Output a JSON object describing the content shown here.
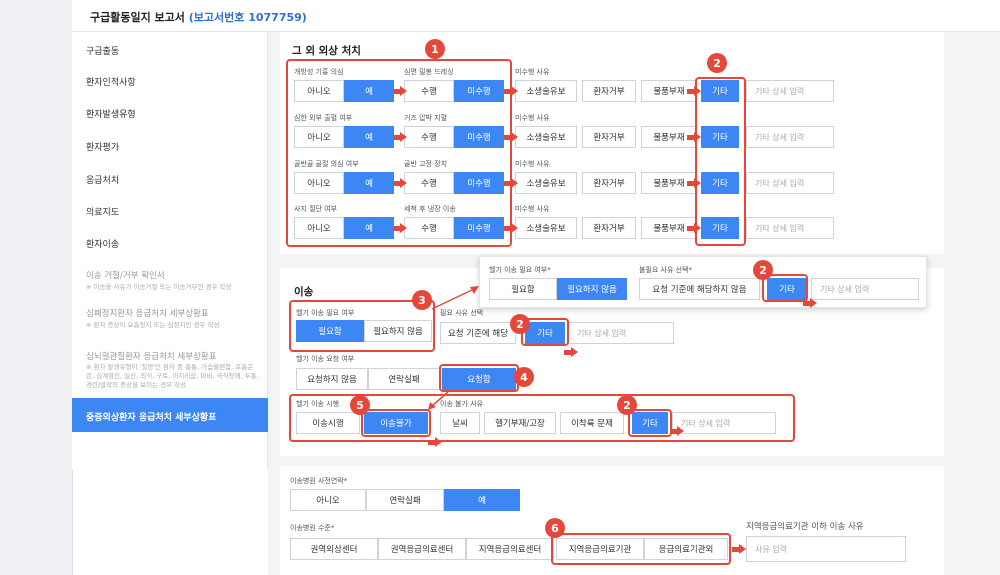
{
  "header": {
    "title": "구급활동일지 보고서",
    "report_no": "(보고서번호 1077759)"
  },
  "sidebar": {
    "items": [
      "구급출동",
      "환자인적사항",
      "환자발생유형",
      "환자평가",
      "응급처치",
      "의료지도",
      "환자이송"
    ],
    "subs": [
      {
        "title": "이송 거절/거부 확인서",
        "note": "※ 이송을 사유가 이송거절 또는 이송거부인 경우 작성"
      },
      {
        "title": "심폐정지환자 응급처치 세부상황표",
        "note": "※ 환자 증상이 요흡정지 또는 심정지인 경우 작성"
      },
      {
        "title": "심뇌혈관질환자 응급처치 세부상황표",
        "note": "※ 환자 발생유형이 '질병'인 환자 중 흉통, 가슴불편함, 호흡곤란, 심계항진, 실신, 의식, 구토, 어지러움, 마비, 극식장애, 두통, 경련/발작의 증상을 보이는 경우 작성"
      }
    ],
    "active": "중증외상환자 응급처치 세부상황표"
  },
  "other_trauma": {
    "title": "그 외 외상 처치",
    "rows": [
      {
        "q1": "개방성 기흉 의심",
        "q2": "심면 밀봉 드레싱"
      },
      {
        "q1": "심한 외부 출혈 여부",
        "q2": "거즈 압박 지혈"
      },
      {
        "q1": "골반골 골절 의심 여부",
        "q2": "골반 고정 장치"
      },
      {
        "q1": "사지 절단 여부",
        "q2": "세척 후 냉장 이송"
      }
    ],
    "reason_label": "미수행 사유",
    "no": "아니오",
    "yes": "예",
    "done": "수행",
    "not_done": "미수행",
    "reasons": [
      "소생술유보",
      "환자거부",
      "물품부재",
      "기타"
    ],
    "detail_placeholder": "기타 상세 입력"
  },
  "transport": {
    "title": "이송",
    "heli_need_label": "헬기 이송 필요 여부",
    "need": "필요함",
    "not_need": "필요하지 않음",
    "need_reason_label": "필요 사유 선택",
    "req_not_applicable": "요청 기준에 해당",
    "etc": "기타",
    "etc_placeholder": "기타 상세 입력",
    "heli_req_label": "헬기 이송 요청 여부",
    "req_options": [
      "요청하지 않음",
      "연락실패",
      "요청함"
    ],
    "heli_exec_label": "헬기 이송 시행",
    "exec_options": [
      "이송시행",
      "이송불가"
    ],
    "unable_label": "이송 불가 사유",
    "unable_options": [
      "날씨",
      "헬기부재/고장",
      "이착륙 문제",
      "기타"
    ]
  },
  "popup": {
    "need_label": "헬기 이송 필요 여부*",
    "unnecessary_label": "불필요 사유 선택*",
    "need": "필요함",
    "not_need": "필요하지 않음",
    "reason": "요청 기준에 해당하지 않음",
    "etc": "기타",
    "placeholder": "기타 상세 입력"
  },
  "hospital": {
    "precontact_label": "이송병원 사전연락*",
    "precontact_options": [
      "아니오",
      "연락실패",
      "예"
    ],
    "level_label": "이송병원 수준*",
    "level_options": [
      "권역외상센터",
      "권역응급의료센터",
      "지역응급의료센터",
      "지역응급의료기관",
      "응급의료기관외"
    ],
    "below_label": "지역응급의료기관 이하 이송 사유",
    "below_placeholder": "사유 입력"
  },
  "badges": [
    "1",
    "2",
    "2",
    "2",
    "3",
    "2",
    "4",
    "5",
    "2",
    "6"
  ],
  "colors": {
    "accent": "#3d87f5",
    "annotation": "#e5483b"
  }
}
